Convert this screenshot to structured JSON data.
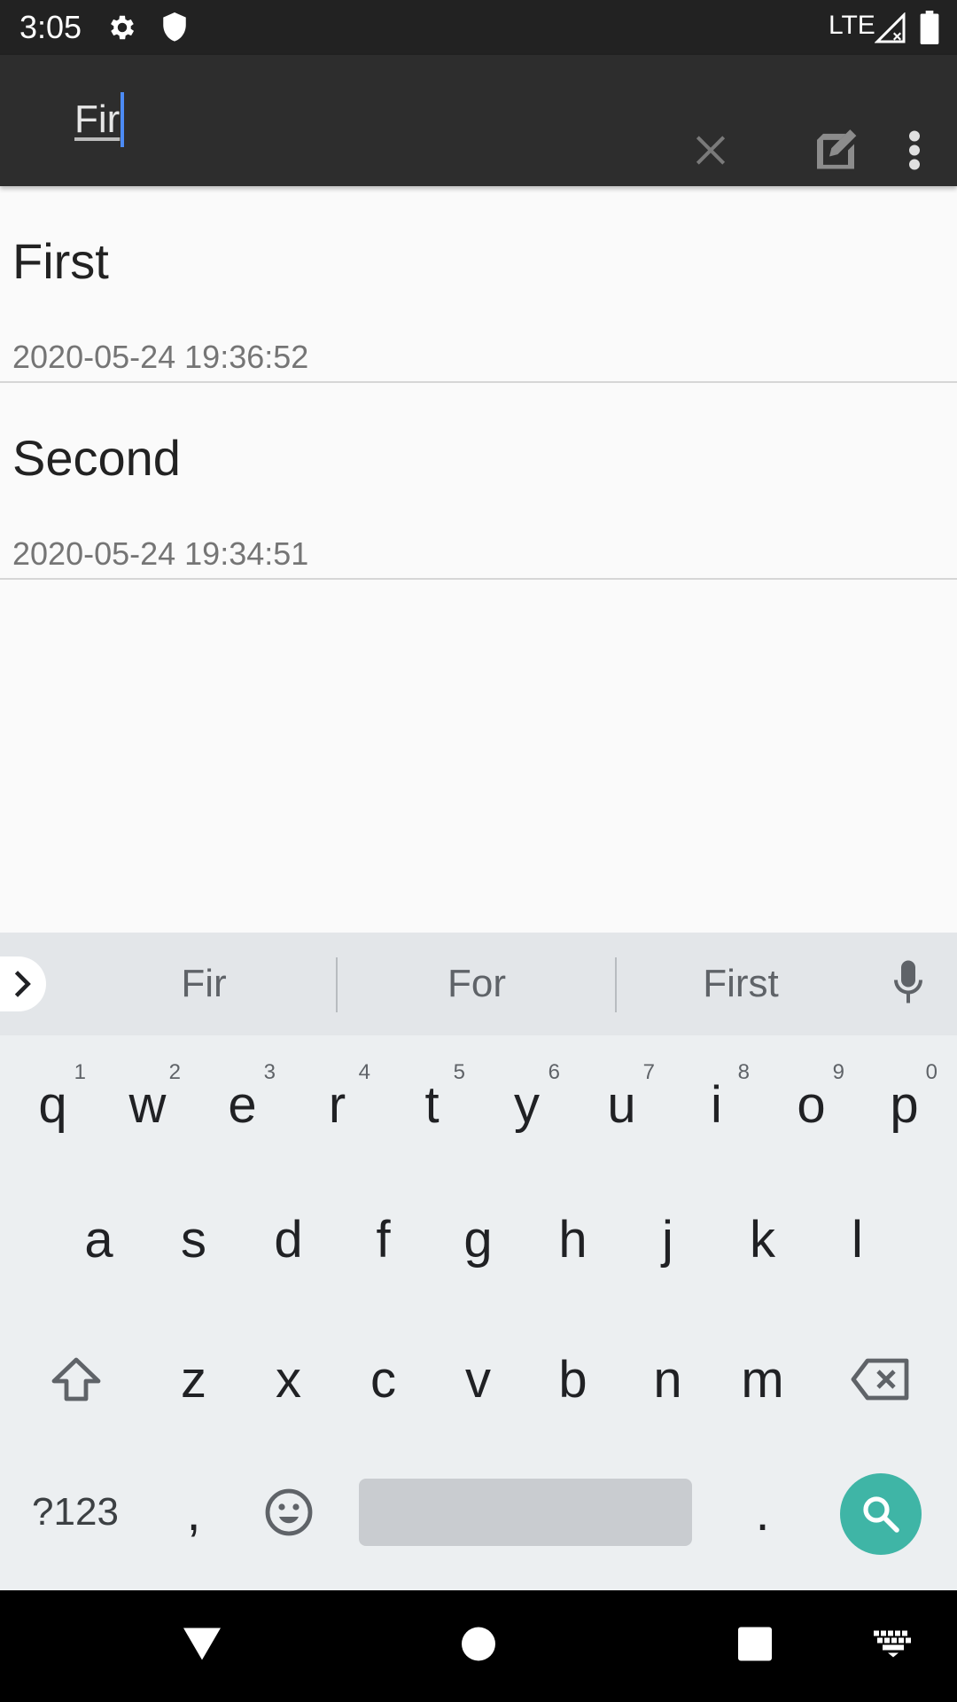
{
  "status_bar": {
    "time": "3:05",
    "network": "LTE",
    "icons": [
      "gear-icon",
      "shield-icon",
      "signal-icon",
      "battery-icon"
    ]
  },
  "toolbar": {
    "search_value": "Fir",
    "icons": [
      "close-icon",
      "compose-icon",
      "overflow-menu-icon"
    ]
  },
  "notes": [
    {
      "title": "First",
      "date": "2020-05-24 19:36:52"
    },
    {
      "title": "Second",
      "date": "2020-05-24 19:34:51"
    }
  ],
  "keyboard": {
    "suggestions": [
      "Fir",
      "For",
      "First"
    ],
    "row1": [
      {
        "key": "q",
        "hint": "1"
      },
      {
        "key": "w",
        "hint": "2"
      },
      {
        "key": "e",
        "hint": "3"
      },
      {
        "key": "r",
        "hint": "4"
      },
      {
        "key": "t",
        "hint": "5"
      },
      {
        "key": "y",
        "hint": "6"
      },
      {
        "key": "u",
        "hint": "7"
      },
      {
        "key": "i",
        "hint": "8"
      },
      {
        "key": "o",
        "hint": "9"
      },
      {
        "key": "p",
        "hint": "0"
      }
    ],
    "row2": [
      "a",
      "s",
      "d",
      "f",
      "g",
      "h",
      "j",
      "k",
      "l"
    ],
    "row3": [
      "z",
      "x",
      "c",
      "v",
      "b",
      "n",
      "m"
    ],
    "symbols_label": "?123",
    "comma": ",",
    "period": ".",
    "accent_color": "#3fb5a6"
  },
  "nav_bar": {
    "icons": [
      "back-icon",
      "home-icon",
      "recents-icon",
      "keyboard-switch-icon"
    ]
  }
}
